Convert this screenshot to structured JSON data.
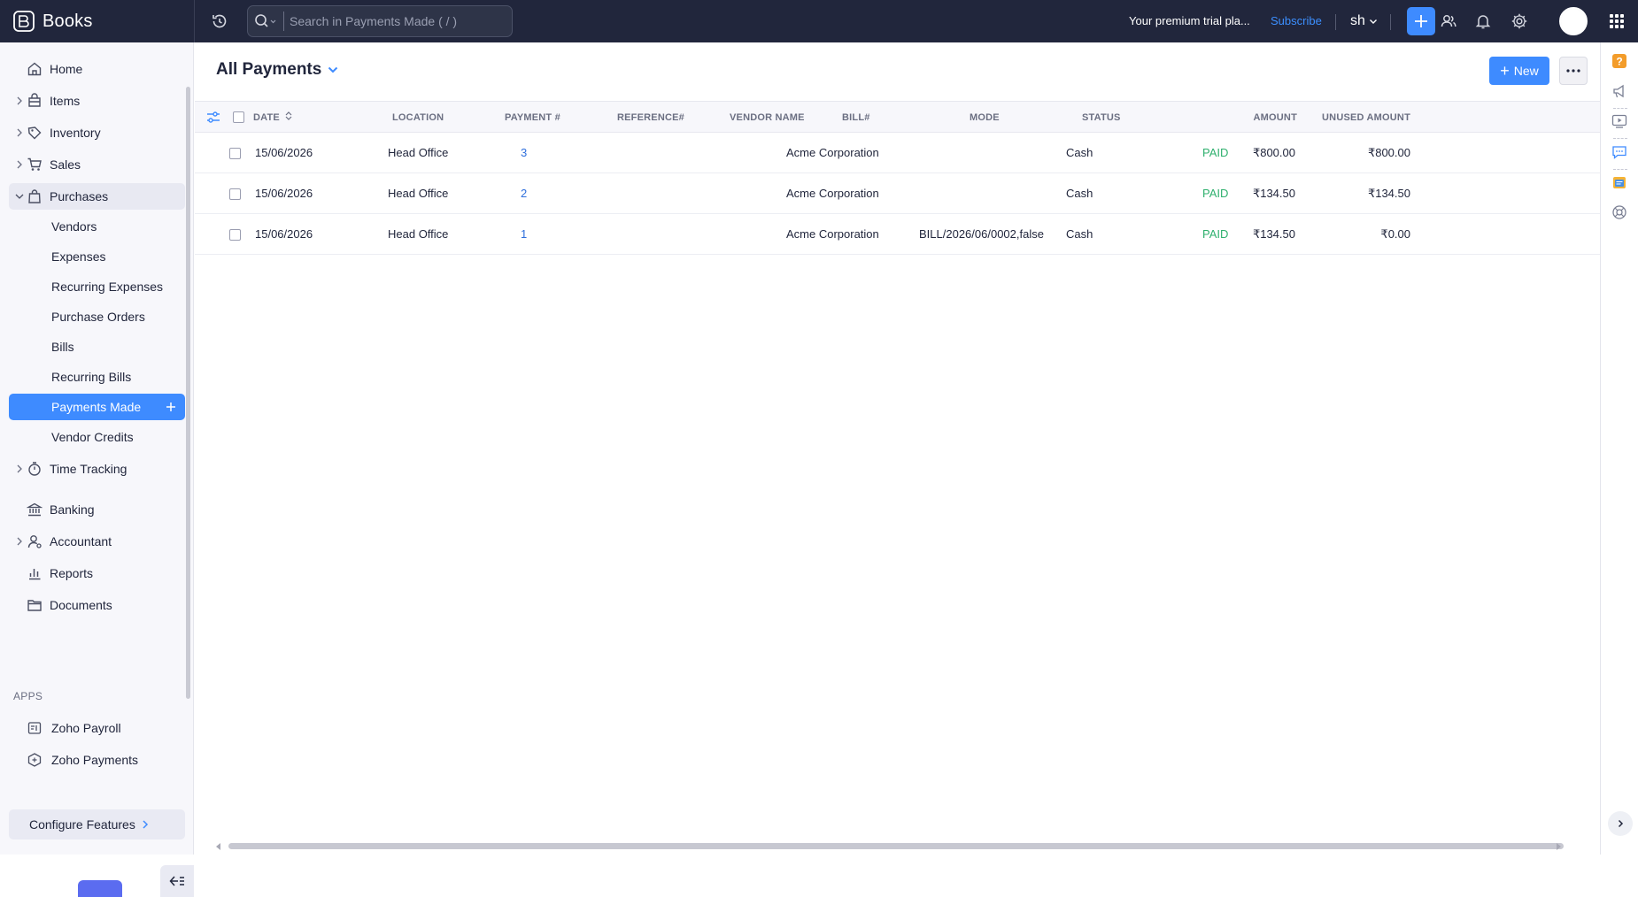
{
  "app": {
    "name": "Books"
  },
  "topbar": {
    "search_placeholder": "Search in Payments Made ( / )",
    "trial_text": "Your premium trial pla...",
    "subscribe_label": "Subscribe",
    "org_label": "sh"
  },
  "sidebar": {
    "items": [
      {
        "label": "Home",
        "icon": "home-icon"
      },
      {
        "label": "Items",
        "icon": "items-icon"
      },
      {
        "label": "Inventory",
        "icon": "inventory-icon"
      },
      {
        "label": "Sales",
        "icon": "cart-icon"
      },
      {
        "label": "Purchases",
        "icon": "bag-icon"
      },
      {
        "label": "Vendors"
      },
      {
        "label": "Expenses"
      },
      {
        "label": "Recurring Expenses"
      },
      {
        "label": "Purchase Orders"
      },
      {
        "label": "Bills"
      },
      {
        "label": "Recurring Bills"
      },
      {
        "label": "Payments Made"
      },
      {
        "label": "Vendor Credits"
      },
      {
        "label": "Time Tracking",
        "icon": "timer-icon"
      },
      {
        "label": "Banking",
        "icon": "bank-icon"
      },
      {
        "label": "Accountant",
        "icon": "accountant-icon"
      },
      {
        "label": "Reports",
        "icon": "reports-icon"
      },
      {
        "label": "Documents",
        "icon": "folder-icon"
      }
    ],
    "apps_heading": "APPS",
    "apps": [
      {
        "label": "Zoho Payroll",
        "icon": "payroll-icon"
      },
      {
        "label": "Zoho Payments",
        "icon": "payments-icon"
      }
    ],
    "configure_label": "Configure Features"
  },
  "main": {
    "view_title": "All Payments",
    "new_label": "New",
    "columns": [
      "DATE",
      "LOCATION",
      "PAYMENT #",
      "REFERENCE#",
      "VENDOR NAME",
      "BILL#",
      "MODE",
      "STATUS",
      "AMOUNT",
      "UNUSED AMOUNT"
    ],
    "rows": [
      {
        "date": "15/06/2026",
        "location": "Head Office",
        "payment": "3",
        "reference": "",
        "vendor": "Acme Corporation",
        "bill": "",
        "mode": "Cash",
        "status": "PAID",
        "amount": "₹800.00",
        "unused": "₹800.00"
      },
      {
        "date": "15/06/2026",
        "location": "Head Office",
        "payment": "2",
        "reference": "",
        "vendor": "Acme Corporation",
        "bill": "",
        "mode": "Cash",
        "status": "PAID",
        "amount": "₹134.50",
        "unused": "₹134.50"
      },
      {
        "date": "15/06/2026",
        "location": "Head Office",
        "payment": "1",
        "reference": "",
        "vendor": "Acme Corporation",
        "bill": "BILL/2026/06/0002,false",
        "mode": "Cash",
        "status": "PAID",
        "amount": "₹134.50",
        "unused": "₹0.00"
      }
    ]
  },
  "colors": {
    "topbar_bg": "#21263c",
    "accent": "#3e8bff",
    "paid": "#2fb06e",
    "link": "#2f6fdc"
  }
}
